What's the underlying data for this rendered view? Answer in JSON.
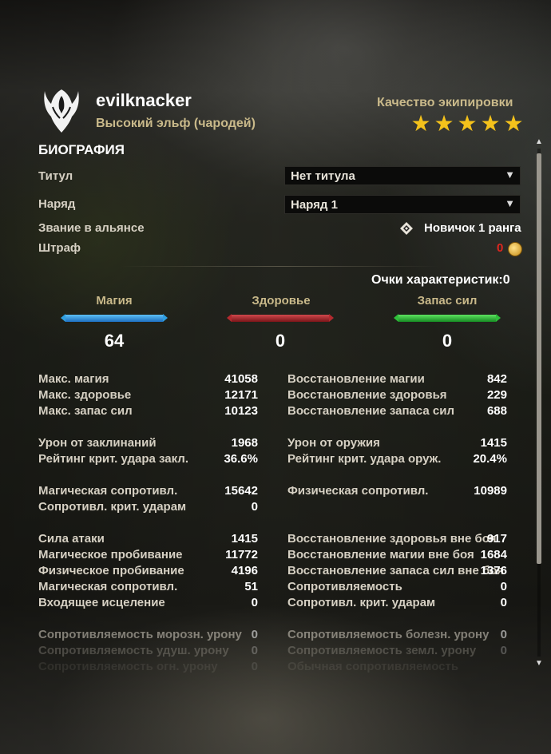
{
  "character": {
    "name": "evilknacker",
    "race_class": "Высокий эльф (чародей)",
    "emblem_icon": "winged-crest-icon"
  },
  "equipment_quality": {
    "label": "Качество экипировки",
    "stars": 5,
    "star_icon": "star-icon"
  },
  "biography": {
    "section_title": "БИОГРАФИЯ",
    "title_label": "Титул",
    "title_value": "Нет титула",
    "outfit_label": "Наряд",
    "outfit_value": "Наряд 1",
    "rank_label": "Звание в альянсе",
    "rank_value": "Новичок 1 ранга",
    "rank_icon": "alliance-rank-icon",
    "bounty_label": "Штраф",
    "bounty_value": "0",
    "bounty_icon": "gold-coin-icon"
  },
  "attribute_points": {
    "label": "Очки характеристик:",
    "value": "0"
  },
  "attributes": [
    {
      "name": "Магия",
      "value": "64",
      "color": "#2f9fe0"
    },
    {
      "name": "Здоровье",
      "value": "0",
      "color": "#b32a2f"
    },
    {
      "name": "Запас сил",
      "value": "0",
      "color": "#2fbf3a"
    }
  ],
  "stats": {
    "g1": {
      "left": [
        {
          "label": "Макс. магия",
          "value": "41058"
        },
        {
          "label": "Макс. здоровье",
          "value": "12171"
        },
        {
          "label": "Макс. запас сил",
          "value": "10123"
        }
      ],
      "right": [
        {
          "label": "Восстановление магии",
          "value": "842"
        },
        {
          "label": "Восстановление здоровья",
          "value": "229"
        },
        {
          "label": "Восстановление запаса сил",
          "value": "688"
        }
      ]
    },
    "g2": {
      "left": [
        {
          "label": "Урон от заклинаний",
          "value": "1968"
        },
        {
          "label": "Рейтинг крит. удара закл.",
          "value": "36.6%"
        }
      ],
      "right": [
        {
          "label": "Урон от оружия",
          "value": "1415"
        },
        {
          "label": "Рейтинг крит. удара оруж.",
          "value": "20.4%"
        }
      ]
    },
    "g3": {
      "left": [
        {
          "label": "Магическая сопротивл.",
          "value": "15642"
        },
        {
          "label": "Сопротивл. крит. ударам",
          "value": "0"
        }
      ],
      "right": [
        {
          "label": "Физическая сопротивл.",
          "value": "10989"
        }
      ]
    },
    "g4": {
      "left": [
        {
          "label": "Сила атаки",
          "value": "1415"
        },
        {
          "label": "Магическое пробивание",
          "value": "11772"
        },
        {
          "label": "Физическое пробивание",
          "value": "4196"
        },
        {
          "label": "Магическая сопротивл.",
          "value": "51"
        },
        {
          "label": "Входящее исцеление",
          "value": "0"
        }
      ],
      "right": [
        {
          "label": "Восстановление здоровья вне боя",
          "value": "917"
        },
        {
          "label": "Восстановление магии вне боя",
          "value": "1684"
        },
        {
          "label": "Восстановление запаса сил вне боя",
          "value": "1376"
        },
        {
          "label": "Сопротивляемость",
          "value": "0"
        },
        {
          "label": "Сопротивл. крит. ударам",
          "value": "0"
        }
      ]
    },
    "g5": {
      "left": [
        {
          "label": "Сопротивляемость морозн. урону",
          "value": "0"
        },
        {
          "label": "Сопротивляемость удуш. урону",
          "value": "0"
        },
        {
          "label": "Сопротивляемость огн. урону",
          "value": "0"
        }
      ],
      "right": [
        {
          "label": "Сопротивляемость болезн. урону",
          "value": "0"
        },
        {
          "label": "Сопротивляемость земл. урону",
          "value": "0"
        },
        {
          "label": "Обычная сопротивляемость",
          "value": ""
        }
      ]
    }
  },
  "scrollbar": {
    "up_icon": "scroll-up-arrow-icon",
    "down_icon": "scroll-down-arrow-icon"
  }
}
